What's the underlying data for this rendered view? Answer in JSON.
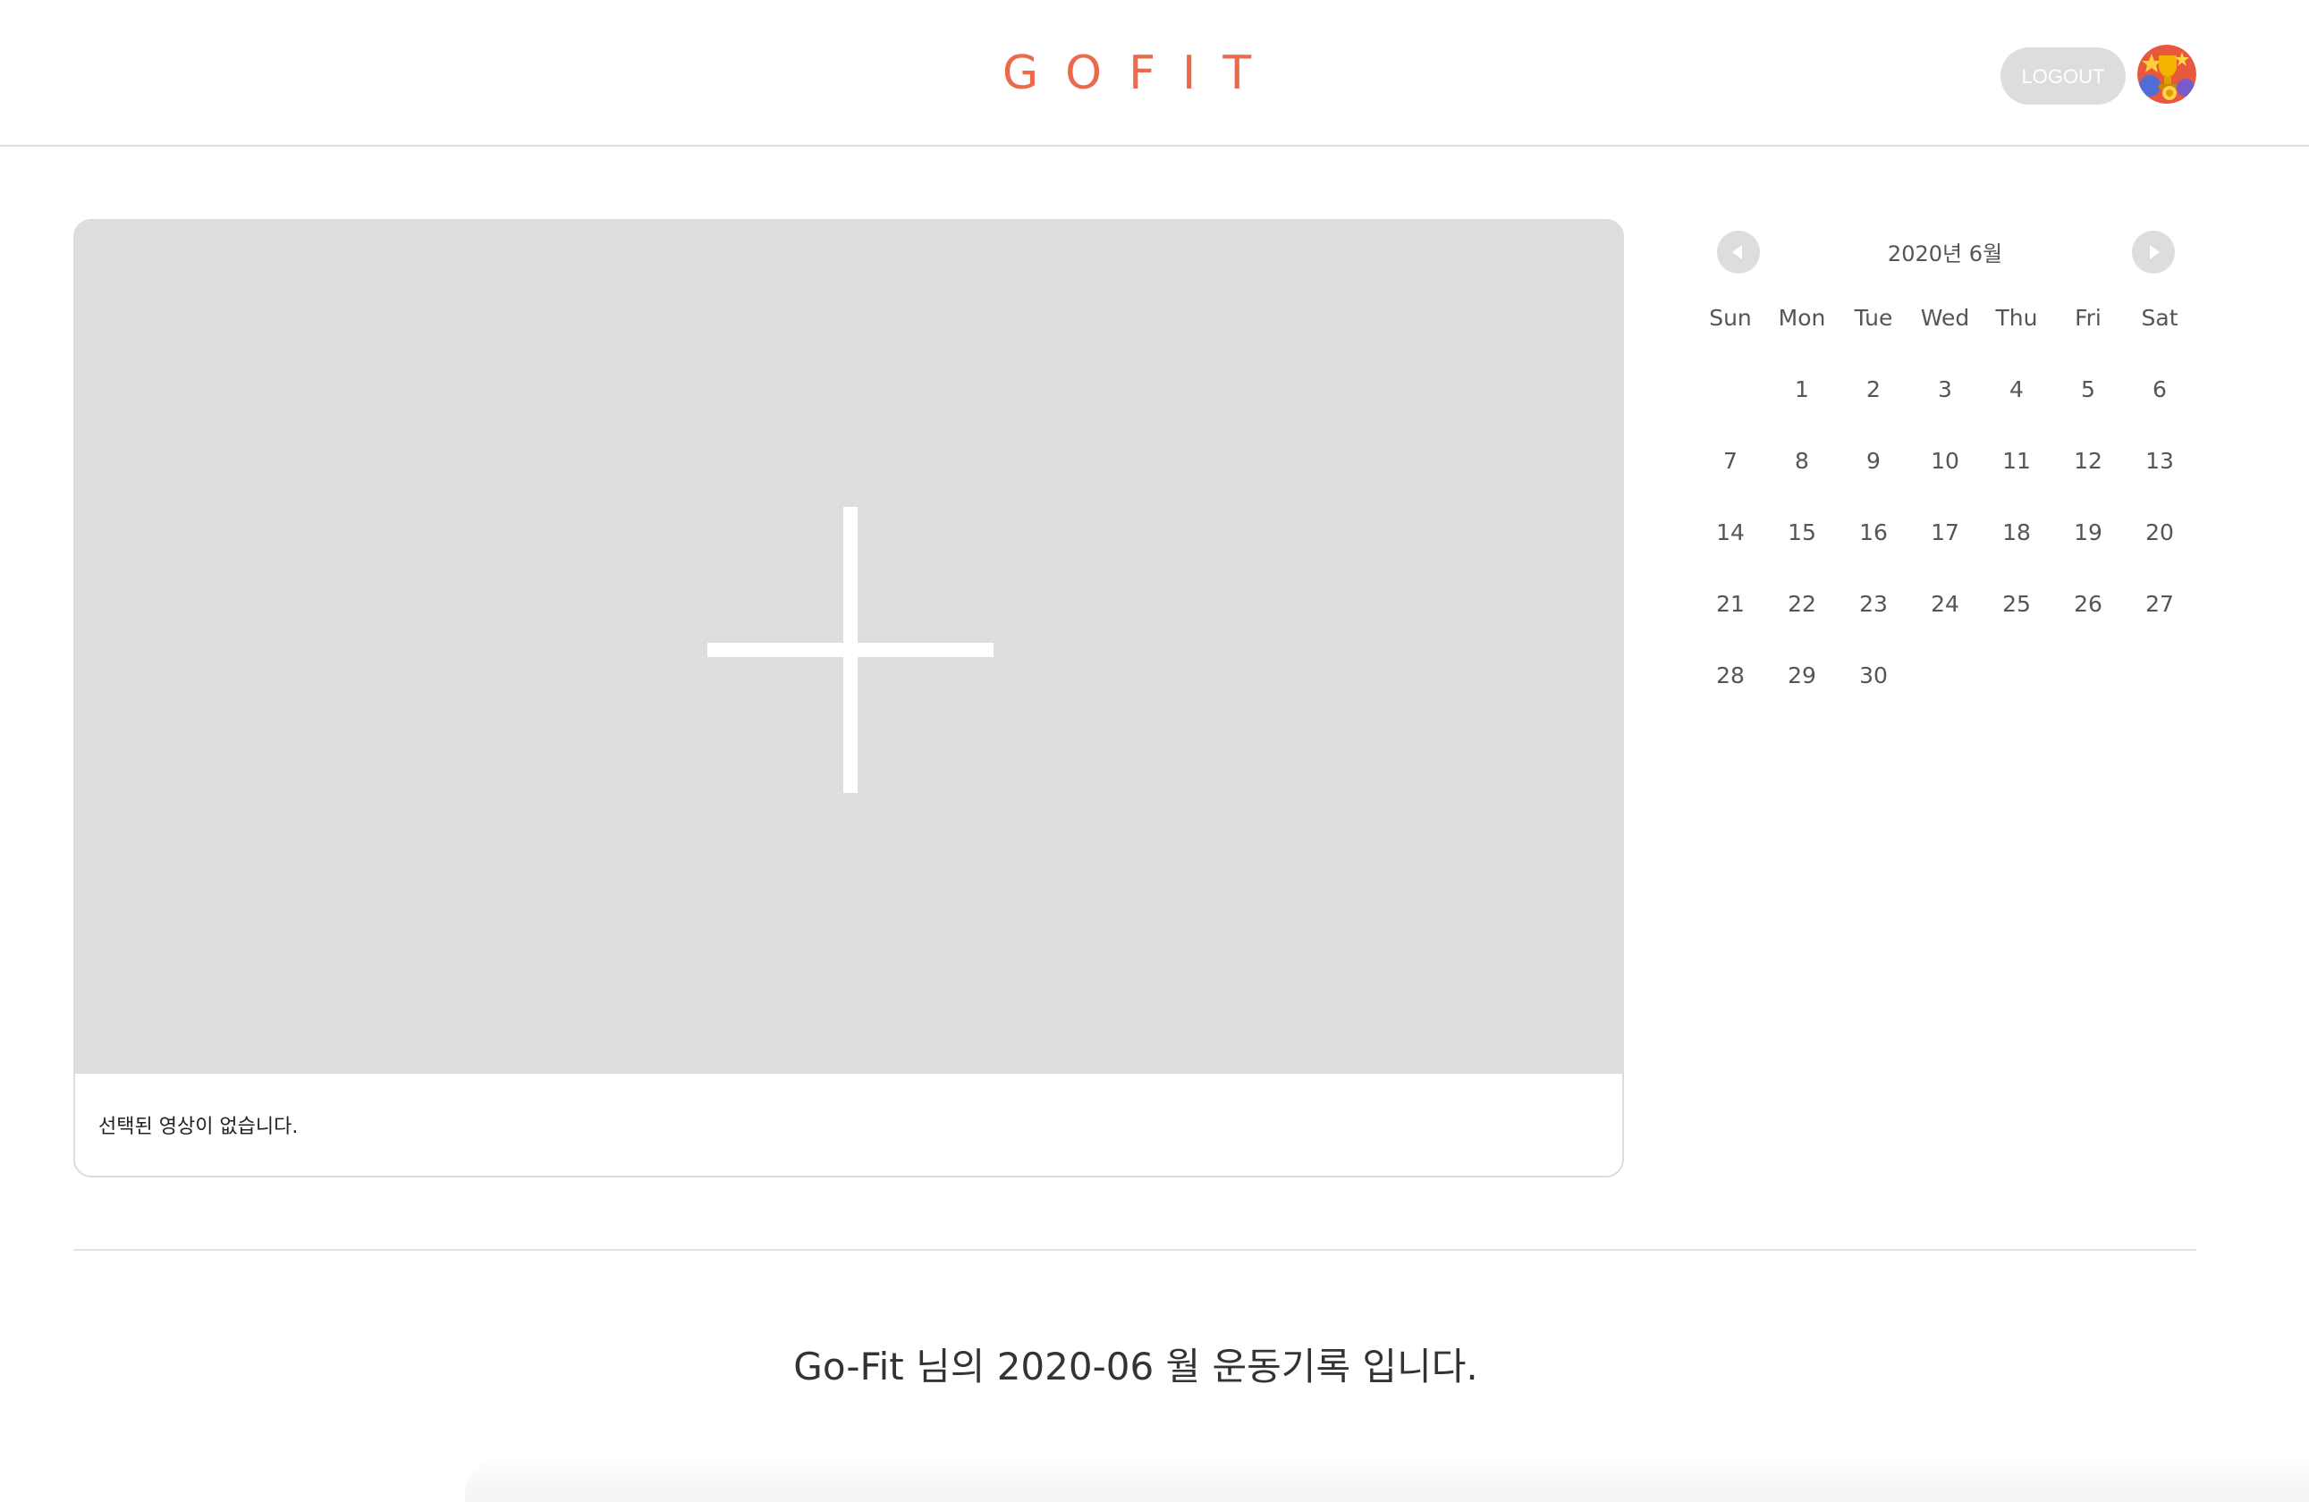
{
  "header": {
    "logo": "GOFIT",
    "logout_label": "LOGOUT",
    "avatar_icon": "trophy-medal-avatar-icon"
  },
  "video": {
    "placeholder_icon": "plus-icon",
    "caption": "선택된 영상이 없습니다."
  },
  "calendar": {
    "title": "2020년 6월",
    "prev_icon": "chevron-left-icon",
    "next_icon": "chevron-right-icon",
    "weekdays": [
      "Sun",
      "Mon",
      "Tue",
      "Wed",
      "Thu",
      "Fri",
      "Sat"
    ],
    "weeks": [
      [
        "",
        "1",
        "2",
        "3",
        "4",
        "5",
        "6"
      ],
      [
        "7",
        "8",
        "9",
        "10",
        "11",
        "12",
        "13"
      ],
      [
        "14",
        "15",
        "16",
        "17",
        "18",
        "19",
        "20"
      ],
      [
        "21",
        "22",
        "23",
        "24",
        "25",
        "26",
        "27"
      ],
      [
        "28",
        "29",
        "30",
        "",
        "",
        "",
        ""
      ]
    ]
  },
  "summary": {
    "text": "Go-Fit 님의 2020-06 월 운동기록 입니다."
  },
  "colors": {
    "brand": "#ec6a4c",
    "placeholder_bg": "#dddddd",
    "button_bg": "#dddddd"
  }
}
